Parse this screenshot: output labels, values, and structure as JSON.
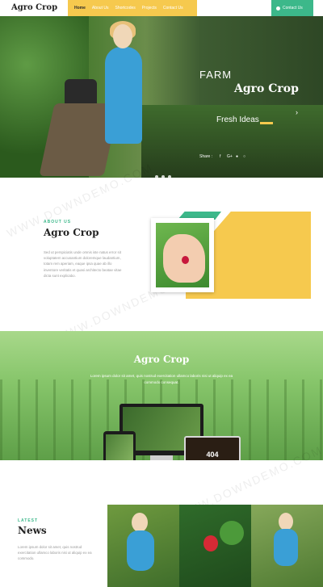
{
  "header": {
    "logo": "Agro Crop",
    "nav": [
      "Home",
      "About Us",
      "Shortcodes",
      "Projects",
      "Contact Us"
    ],
    "contact_button": "Contact Us"
  },
  "hero": {
    "farm": "FARM",
    "title": "Agro Crop",
    "subtitle": "Fresh Ideas",
    "share_label": "Share :",
    "social_icons": [
      "facebook-icon",
      "google-plus-icon",
      "twitter-icon",
      "pinterest-icon"
    ],
    "slide_dots": 3
  },
  "about": {
    "label": "ABOUT US",
    "title": "Agro Crop",
    "text": "Sed ut perspiciatis unde omnis iste natus error sit voluptatem accusantium doloremque laudantium, totam rem aperiam, eaque ipsa quae ab illo inventore veritatis et quasi architecto beatae vitae dicta sunt explicabo."
  },
  "banner": {
    "title": "Agro Crop",
    "text": "Lorem ipsum dolor sit amet, quis nostrud exercitation ullamco laboris nisi ut aliquip ex ea commodo consequat.",
    "laptop_screen": "404"
  },
  "news": {
    "label": "LATEST",
    "title": "News",
    "text": "Lorem ipsum dolor sit amet, quis nostrud exercitation ullamco laboris nisi ut aliquip ex ea commodo."
  },
  "watermark": "WWW.DOWNDEMO.COM",
  "colors": {
    "accent_yellow": "#f6c94e",
    "accent_teal": "#3cb88a"
  }
}
